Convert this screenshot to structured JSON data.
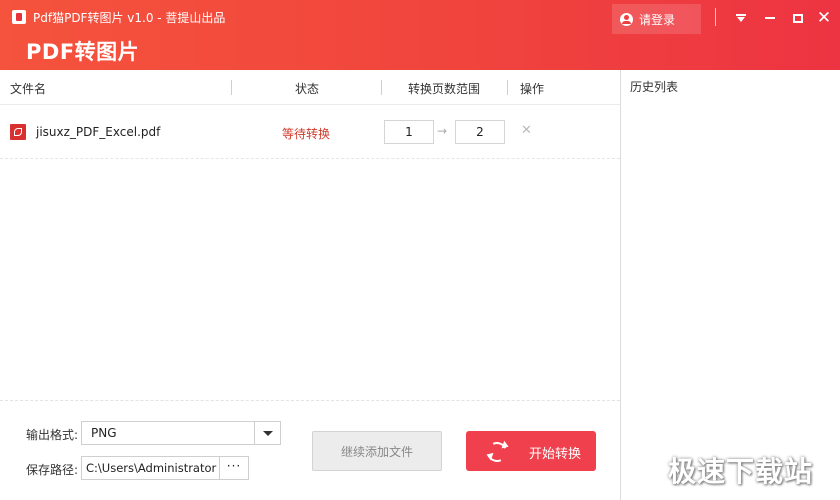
{
  "window": {
    "title": "Pdf猫PDF转图片 v1.0 - 菩提山出品",
    "heading": "PDF转图片",
    "login_label": "请登录",
    "brand_color": "#f0443d"
  },
  "table": {
    "columns": [
      "文件名",
      "状态",
      "转换页数范围",
      "操作"
    ],
    "rows": [
      {
        "file_name": "jisuxz_PDF_Excel.pdf",
        "status": "等待转换",
        "page_from": "1",
        "page_to": "2"
      }
    ]
  },
  "icons": {
    "app": "app-logo-icon",
    "user": "user-icon",
    "menu": "menu-icon",
    "minimize": "minimize-icon",
    "maximize": "maximize-icon",
    "close": "close-icon",
    "file": "pdf-file-icon",
    "arrow": "arrow-right-icon",
    "delete": "delete-icon",
    "refresh": "refresh-icon"
  },
  "history": {
    "title": "历史列表"
  },
  "bottom": {
    "format_label": "输出格式:",
    "format_value": "PNG",
    "path_label": "保存路径:",
    "path_value": "C:\\Users\\Administrator",
    "browse_label": "···",
    "add_button": "继续添加文件",
    "start_button": "开始转换"
  },
  "watermark": "极速下载站"
}
